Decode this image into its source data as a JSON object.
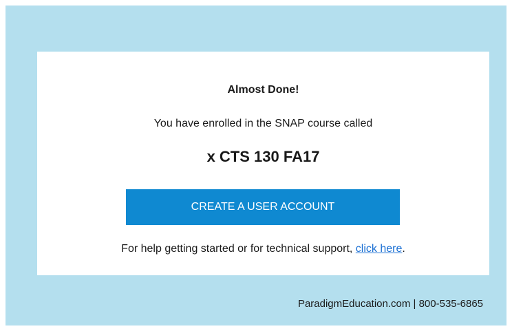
{
  "colors": {
    "background_frame": "#b4dfee",
    "card": "#ffffff",
    "button": "#0f89d1",
    "button_text": "#ffffff",
    "link": "#1a6fd3",
    "text": "#1a1a1a"
  },
  "card": {
    "heading": "Almost Done!",
    "intro": "You have enrolled in the SNAP course called",
    "course_name": "x CTS 130 FA17",
    "cta_label": "CREATE A USER ACCOUNT",
    "help_prefix": "For help getting started or for technical support, ",
    "help_link": "click here",
    "help_suffix": "."
  },
  "footer": {
    "text": "ParadigmEducation.com | 800-535-6865"
  }
}
